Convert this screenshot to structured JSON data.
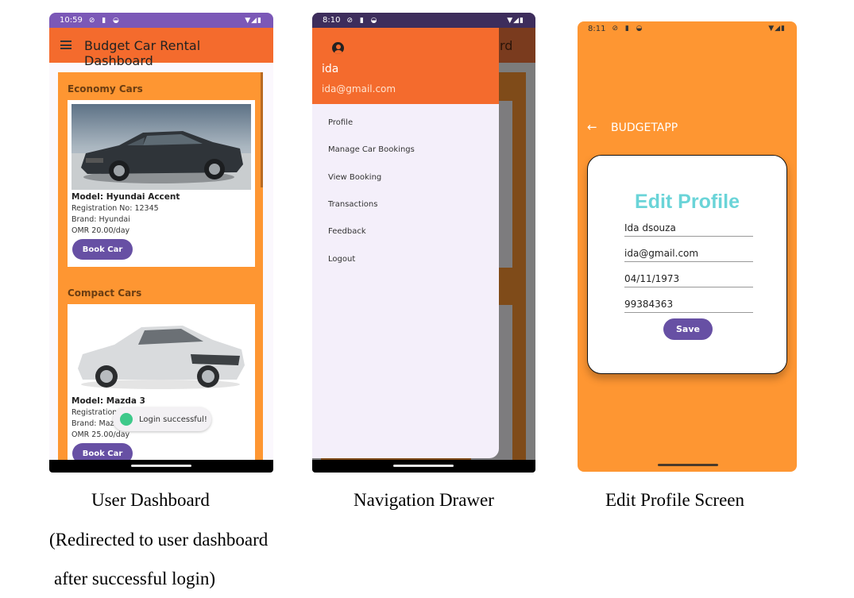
{
  "phone1": {
    "status_time": "10:59",
    "app_title": "Budget Car Rental Dashboard",
    "sections": [
      {
        "title": "Economy Cars",
        "model": "Model: Hyundai Accent",
        "registration": "Registration No: 12345",
        "brand": "Brand: Hyundai",
        "price": "OMR 20.00/day",
        "button": "Book Car"
      },
      {
        "title": "Compact Cars",
        "model": "Model: Mazda 3",
        "registration": "Registration",
        "brand": "Brand: Maz",
        "price": "OMR 25.00/day",
        "button": "Book Car"
      }
    ],
    "toast": "Login successful!"
  },
  "phone2": {
    "status_time": "8:10",
    "bg_title_fragment": "rd",
    "user_name": "ida",
    "user_email": "ida@gmail.com",
    "menu": [
      "Profile",
      "Manage Car Bookings",
      "View Booking",
      "Transactions",
      "Feedback",
      "Logout"
    ]
  },
  "phone3": {
    "status_time": "8:11",
    "toolbar_title": "BUDGETAPP",
    "heading": "Edit Profile",
    "fields": [
      "Ida dsouza",
      "ida@gmail.com",
      "04/11/1973",
      "99384363"
    ],
    "save_button": "Save"
  },
  "captions": {
    "c1_line1": "User Dashboard",
    "c1_line2": "(Redirected to user dashboard",
    "c1_line3": "after successful login)",
    "c2": "Navigation Drawer",
    "c3": "Edit Profile Screen"
  },
  "colors": {
    "orange_appbar": "#f46b2d",
    "orange_bg": "#fe9632",
    "purple": "#6750a4",
    "status_purple": "#7b58b7",
    "heading_teal": "#6ad4d8"
  }
}
